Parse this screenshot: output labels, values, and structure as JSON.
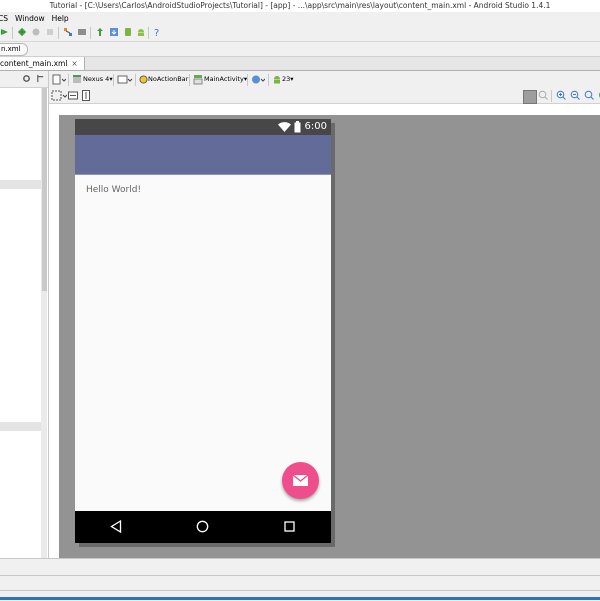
{
  "window": {
    "title": "Tutorial - [C:\\Users\\Carlos\\AndroidStudioProjects\\Tutorial] - [app] - ...\\app\\src\\main\\res\\layout\\content_main.xml - Android Studio 1.4.1"
  },
  "menu": {
    "items": [
      "CS",
      "Window",
      "Help"
    ]
  },
  "navbar": {
    "crumb": "n.xml"
  },
  "editor": {
    "tab_label": "content_main.xml",
    "tab_close": "×"
  },
  "designer": {
    "device": "Nexus 4",
    "theme": "NoActionBar",
    "activity": "MainActivity",
    "api_level": "23"
  },
  "phone": {
    "clock": "6:00",
    "hello_text": "Hello World!",
    "colors": {
      "status_bar": "#474747",
      "app_bar": "#636b98",
      "fab": "#ef4e8d",
      "nav_bar": "#000000"
    }
  },
  "icons": {
    "toolbar": [
      "sync-icon",
      "debug-icon",
      "attach-icon",
      "structure-icon",
      "sdk-icon",
      "download-icon",
      "android-monitor-icon",
      "help-icon"
    ]
  }
}
